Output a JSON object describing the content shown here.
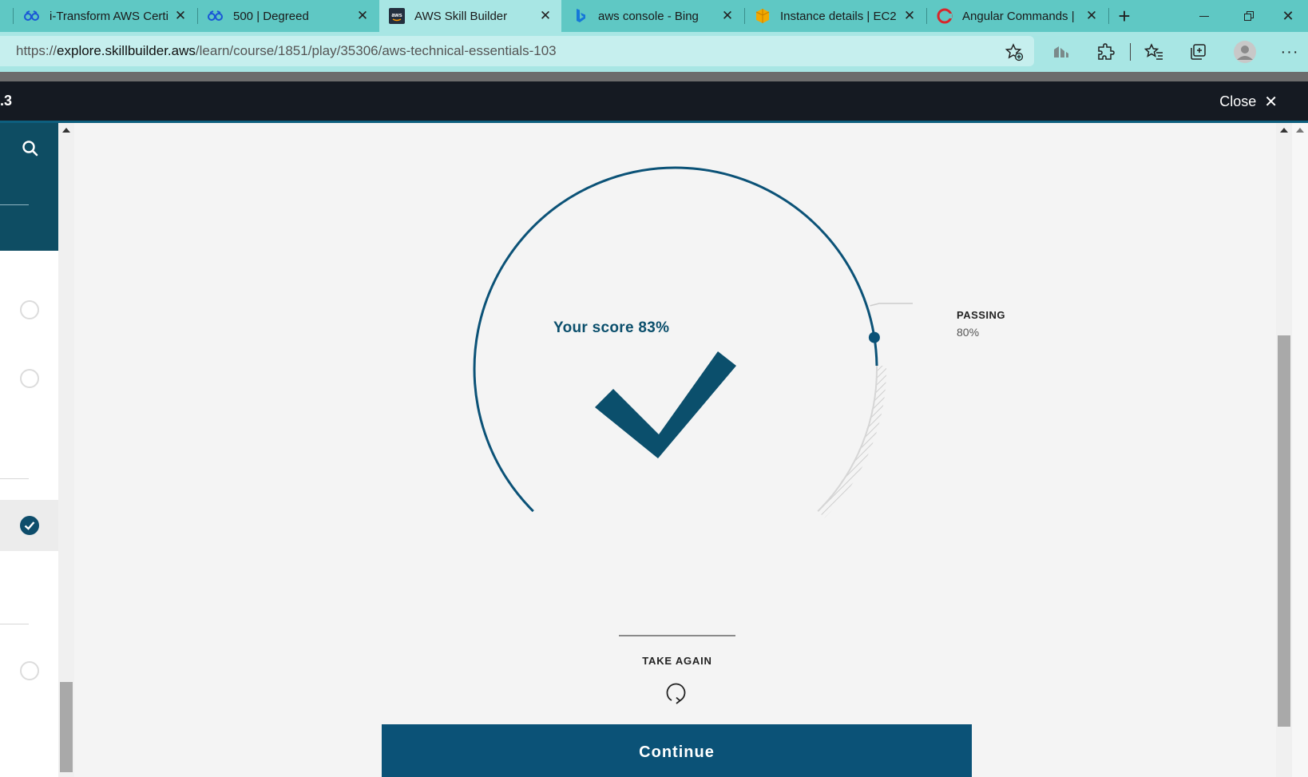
{
  "browser": {
    "tabs": [
      {
        "label": "i-Transform AWS Certi",
        "icon": "degreed-icon",
        "active": false
      },
      {
        "label": "500 | Degreed",
        "icon": "degreed-icon",
        "active": false
      },
      {
        "label": "AWS Skill Builder",
        "icon": "aws-icon",
        "active": true
      },
      {
        "label": "aws console - Bing",
        "icon": "bing-icon",
        "active": false
      },
      {
        "label": "Instance details | EC2",
        "icon": "ec2-icon",
        "active": false
      },
      {
        "label": "Angular Commands |",
        "icon": "angular-icon",
        "active": false
      }
    ],
    "new_tab_label": "+",
    "url": {
      "scheme": "https://",
      "host": "explore.skillbuilder.aws",
      "path": "/learn/course/1851/play/35306/aws-technical-essentials-103"
    }
  },
  "app": {
    "crumb": ".3",
    "close_label": "Close",
    "close_icon": "close-icon"
  },
  "sidebar": {
    "search_icon": "search-icon",
    "items": [
      {
        "state": "incomplete"
      },
      {
        "state": "incomplete"
      },
      {
        "state": "complete",
        "active": true
      },
      {
        "state": "incomplete"
      }
    ]
  },
  "result": {
    "score_text": "Your score 83%",
    "score_percent": 83,
    "passing_label": "PASSING",
    "passing_value": "80%",
    "passing_percent": 80,
    "take_again_label": "TAKE AGAIN",
    "continue_label": "Continue"
  },
  "colors": {
    "accent": "#0b5277",
    "tabstrip": "#5fc8c4",
    "toolbar": "#a8e6e4",
    "appbar": "#151a22"
  }
}
